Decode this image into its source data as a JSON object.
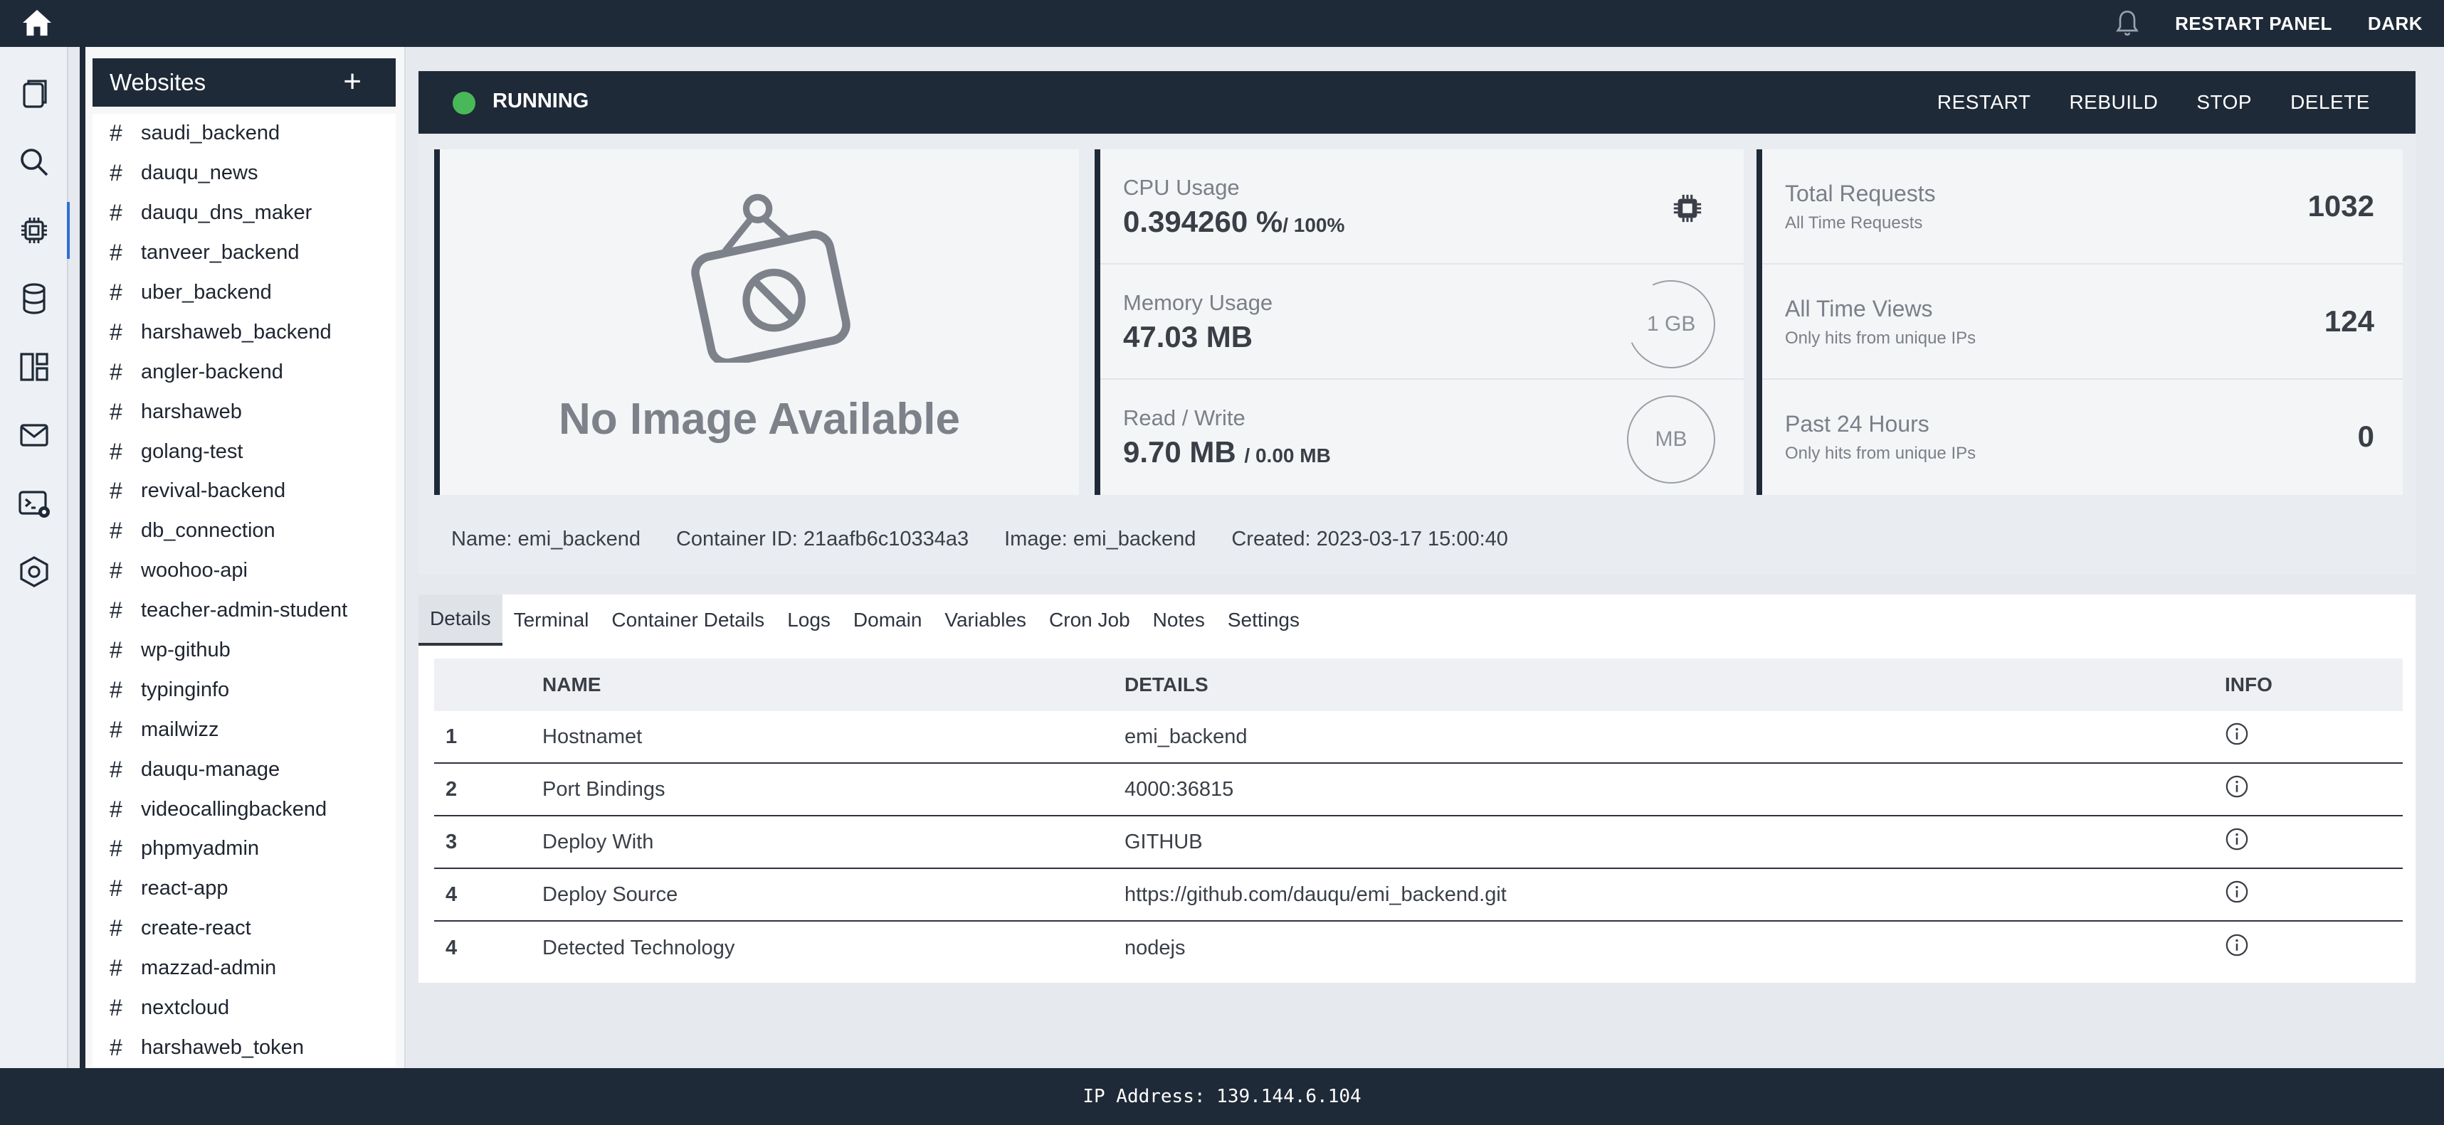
{
  "topbar": {
    "home_icon": "home-icon",
    "bell_icon": "bell-icon",
    "restart_panel_label": "RESTART PANEL",
    "theme_label": "DARK"
  },
  "rail": {
    "items": [
      "pages-icon",
      "search-icon",
      "chip-icon",
      "database-icon",
      "dashboard-icon",
      "mail-icon",
      "terminal-settings-icon",
      "hexagon-settings-icon"
    ],
    "active_index": 2
  },
  "sidebar": {
    "title": "Websites",
    "add_label": "+",
    "hash": "#",
    "sites": [
      "saudi_backend",
      "dauqu_news",
      "dauqu_dns_maker",
      "tanveer_backend",
      "uber_backend",
      "harshaweb_backend",
      "angler-backend",
      "harshaweb",
      "golang-test",
      "revival-backend",
      "db_connection",
      "woohoo-api",
      "teacher-admin-student",
      "wp-github",
      "typinginfo",
      "mailwizz",
      "dauqu-manage",
      "videocallingbackend",
      "phpmyadmin",
      "react-app",
      "create-react",
      "mazzad-admin",
      "nextcloud",
      "harshaweb_token"
    ]
  },
  "status": {
    "text": "RUNNING",
    "color": "#49b859",
    "actions": [
      "RESTART",
      "REBUILD",
      "STOP",
      "DELETE"
    ]
  },
  "image_card": {
    "text": "No Image Available"
  },
  "metrics": {
    "cpu": {
      "label": "CPU Usage",
      "value": "0.394260 %",
      "sub": "/ 100%"
    },
    "memory": {
      "label": "Memory Usage",
      "value": "47.03 MB",
      "gauge": "1 GB"
    },
    "rw": {
      "label": "Read / Write",
      "value": "9.70 MB",
      "sub": "/ 0.00 MB",
      "gauge": "MB"
    }
  },
  "stats": [
    {
      "label": "Total Requests",
      "sub": "All Time Requests",
      "value": "1032"
    },
    {
      "label": "All Time Views",
      "sub": "Only hits from unique IPs",
      "value": "124"
    },
    {
      "label": "Past 24 Hours",
      "sub": "Only hits from unique IPs",
      "value": "0"
    }
  ],
  "meta": {
    "name": "Name: emi_backend",
    "container_id": "Container ID: 21aafb6c10334a3",
    "image": "Image: emi_backend",
    "created": "Created: 2023-03-17 15:00:40"
  },
  "tabs": [
    "Details",
    "Terminal",
    "Container Details",
    "Logs",
    "Domain",
    "Variables",
    "Cron Job",
    "Notes",
    "Settings"
  ],
  "table": {
    "headers": {
      "num": "",
      "name": "NAME",
      "details": "DETAILS",
      "info": "INFO"
    },
    "rows": [
      {
        "num": "1",
        "name": "Hostnamet",
        "details": "emi_backend"
      },
      {
        "num": "2",
        "name": "Port Bindings",
        "details": "4000:36815"
      },
      {
        "num": "3",
        "name": "Deploy With",
        "details": "GITHUB"
      },
      {
        "num": "4",
        "name": "Deploy Source",
        "details": "https://github.com/dauqu/emi_backend.git"
      },
      {
        "num": "4",
        "name": "Detected Technology",
        "details": "nodejs"
      }
    ]
  },
  "footer": {
    "ip_text": "IP Address: 139.144.6.104"
  }
}
